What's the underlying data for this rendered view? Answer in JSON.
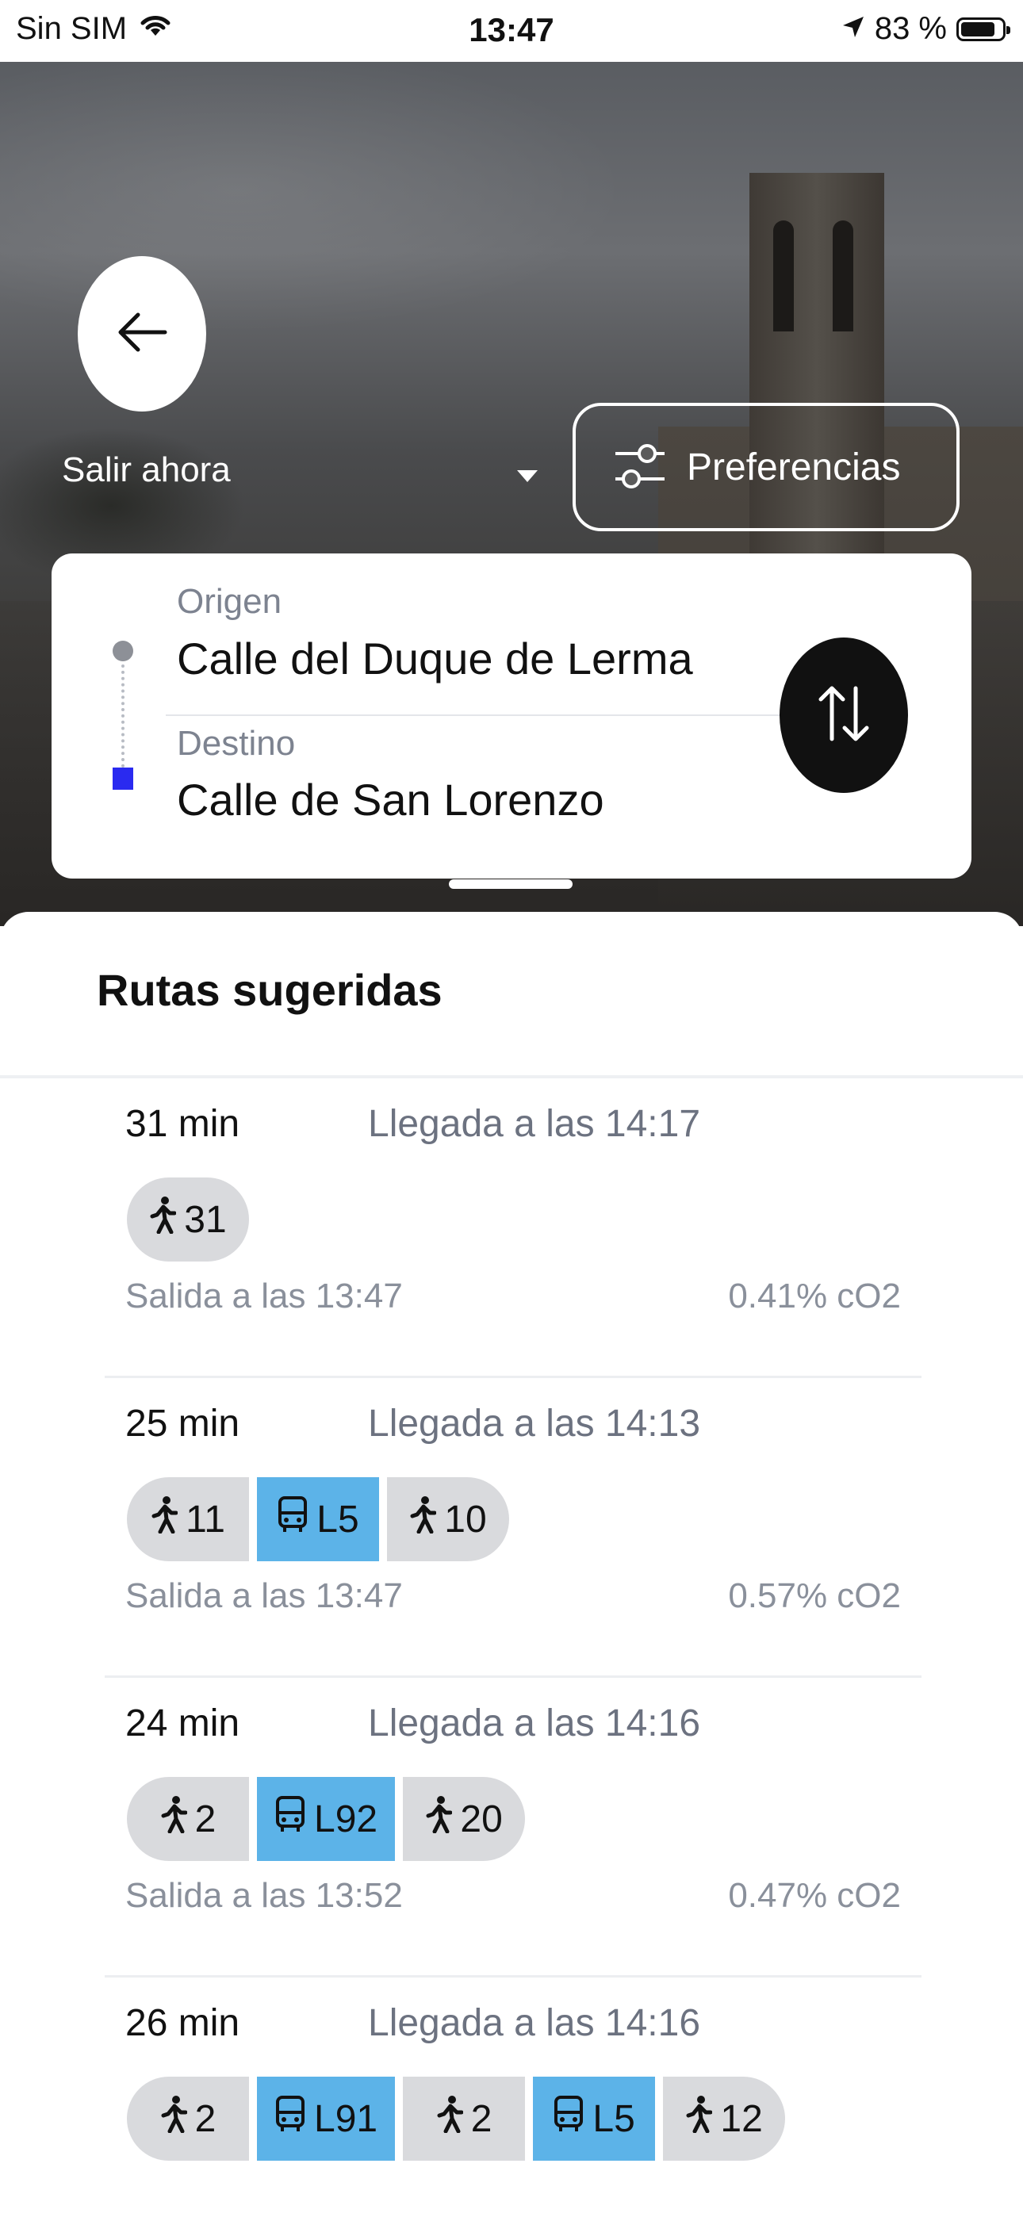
{
  "status_bar": {
    "carrier": "Sin SIM",
    "time": "13:47",
    "battery_percent": "83 %",
    "icons": [
      "wifi-icon",
      "location-arrow-icon",
      "battery-icon"
    ]
  },
  "header": {
    "back_icon": "arrow-left-icon",
    "leave_now_label": "Salir ahora",
    "preferences_label": "Preferencias",
    "preferences_icon": "sliders-icon"
  },
  "route_card": {
    "origin_label": "Origen",
    "origin_value": "Calle del Duque de Lerma",
    "destination_label": "Destino",
    "destination_value": "Calle de San Lorenzo",
    "swap_icon": "swap-vertical-icon"
  },
  "routes_section": {
    "title": "Rutas sugeridas",
    "routes": [
      {
        "duration": "31 min",
        "arrival": "Llegada a las 14:17",
        "departure": "Salida a las 13:47",
        "co2": "0.41% cO2",
        "segments": [
          {
            "type": "walk",
            "icon": "walk-icon",
            "label": "31"
          }
        ]
      },
      {
        "duration": "25 min",
        "arrival": "Llegada a las 14:13",
        "departure": "Salida a las 13:47",
        "co2": "0.57% cO2",
        "segments": [
          {
            "type": "walk",
            "icon": "walk-icon",
            "label": "11"
          },
          {
            "type": "bus",
            "icon": "bus-icon",
            "label": "L5"
          },
          {
            "type": "walk",
            "icon": "walk-icon",
            "label": "10"
          }
        ]
      },
      {
        "duration": "24 min",
        "arrival": "Llegada a las 14:16",
        "departure": "Salida a las 13:52",
        "co2": "0.47% cO2",
        "segments": [
          {
            "type": "walk",
            "icon": "walk-icon",
            "label": "2"
          },
          {
            "type": "bus",
            "icon": "bus-icon",
            "label": "L92"
          },
          {
            "type": "walk",
            "icon": "walk-icon",
            "label": "20"
          }
        ]
      },
      {
        "duration": "26 min",
        "arrival": "Llegada a las 14:16",
        "departure": "",
        "co2": "",
        "segments": [
          {
            "type": "walk",
            "icon": "walk-icon",
            "label": "2"
          },
          {
            "type": "bus",
            "icon": "bus-icon",
            "label": "L91"
          },
          {
            "type": "walk",
            "icon": "walk-icon",
            "label": "2"
          },
          {
            "type": "bus",
            "icon": "bus-icon",
            "label": "L5"
          },
          {
            "type": "walk",
            "icon": "walk-icon",
            "label": "12"
          }
        ]
      }
    ]
  },
  "colors": {
    "bus_chip": "#5cb3e8",
    "walk_chip": "#d9dadd",
    "destination_marker": "#2a2af0",
    "swap_button": "#111111"
  }
}
